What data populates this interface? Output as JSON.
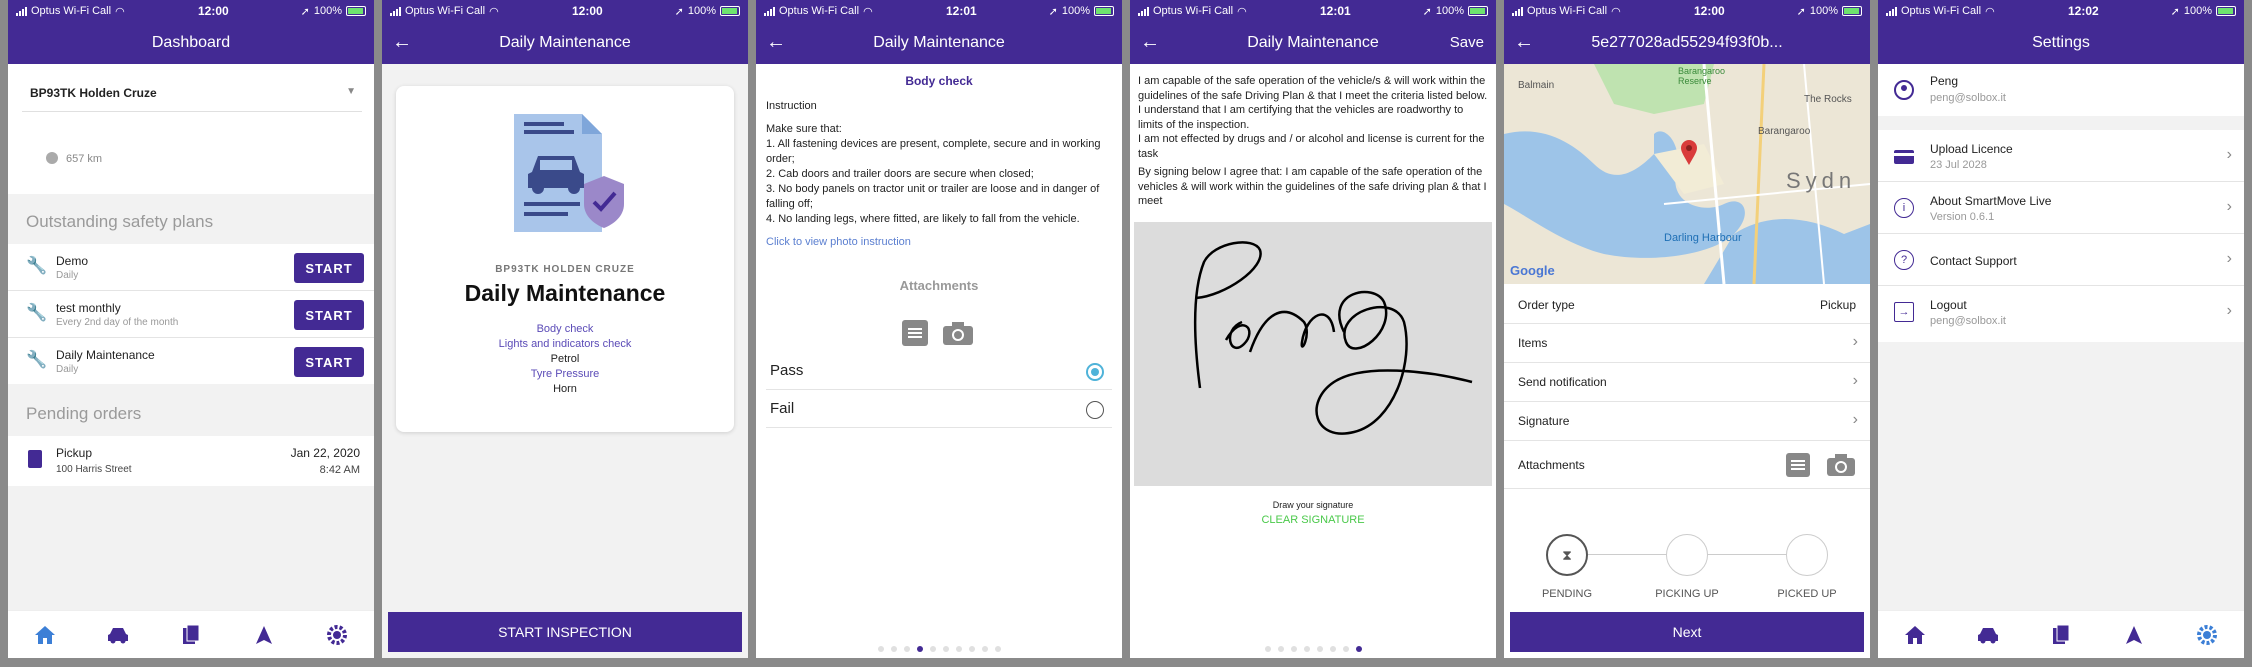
{
  "status": {
    "carrier": "Optus Wi-Fi Call",
    "battery": "100%",
    "times": [
      "12:00",
      "12:00",
      "12:01",
      "12:01",
      "12:00",
      "12:02"
    ]
  },
  "dashboard": {
    "title": "Dashboard",
    "vehicle": "BP93TK Holden Cruze",
    "odometer": "657 km",
    "safety_heading": "Outstanding safety plans",
    "plans": [
      {
        "name": "Demo",
        "freq": "Daily",
        "button": "START"
      },
      {
        "name": "test monthly",
        "freq": "Every 2nd day of the month",
        "button": "START"
      },
      {
        "name": "Daily Maintenance",
        "freq": "Daily",
        "button": "START"
      }
    ],
    "pending_heading": "Pending orders",
    "order": {
      "type": "Pickup",
      "address": "100 Harris Street",
      "date": "Jan 22, 2020",
      "time": "8:42 AM"
    }
  },
  "maintenance": {
    "title": "Daily Maintenance",
    "vehicle": "BP93TK HOLDEN CRUZE",
    "plan_name": "Daily Maintenance",
    "checks": [
      "Body check",
      "Lights and indicators check",
      "Petrol",
      "Tyre Pressure",
      "Horn"
    ],
    "start_button": "START INSPECTION"
  },
  "bodycheck": {
    "title": "Daily Maintenance",
    "heading": "Body check",
    "instruction_label": "Instruction",
    "instruction_lines": [
      "Make sure that:",
      "1. All fastening devices are present, complete, secure and in working order;",
      "2. Cab doors and trailer doors are secure when closed;",
      "3. No body panels on tractor unit or trailer are loose and in danger of falling off;",
      "4. No landing legs, where fitted, are likely to fall from the vehicle."
    ],
    "photo_link": "Click to view photo instruction",
    "attachments_label": "Attachments",
    "options": [
      "Pass",
      "Fail"
    ],
    "selected": "Pass"
  },
  "signature": {
    "title": "Daily Maintenance",
    "save": "Save",
    "para1": "I am capable of the safe operation of the vehicle/s & will work within the guidelines of the safe Driving Plan & that I meet the criteria listed below. I understand that I am certifying that the vehicles are roadworthy to limits of the inspection.",
    "para2": "I am not effected by drugs and / or alcohol and license is current for the task",
    "para3": "By signing below I agree that: I am capable of the safe operation of the vehicles & will work within the guidelines of the safe driving plan & that I meet",
    "draw_label": "Draw your signature",
    "clear_label": "CLEAR SIGNATURE"
  },
  "order": {
    "title": "5e277028ad55294f93f0b...",
    "map_labels": {
      "balmain": "Balmain",
      "reserve": "Barangaroo Reserve",
      "rocks": "The Rocks",
      "barangaroo": "Barangaroo",
      "sydney": "Sydn",
      "darling": "Darling Harbour",
      "google": "Google"
    },
    "order_type_label": "Order type",
    "order_type_value": "Pickup",
    "rows": [
      "Items",
      "Send notification",
      "Signature"
    ],
    "attachments_label": "Attachments",
    "steps": [
      "PENDING",
      "PICKING UP",
      "PICKED UP"
    ],
    "next_button": "Next"
  },
  "settings": {
    "title": "Settings",
    "user_name": "Peng",
    "user_email": "peng@solbox.it",
    "items": [
      {
        "label": "Upload Licence",
        "sub": "23 Jul 2028"
      },
      {
        "label": "About SmartMove Live",
        "sub": "Version 0.6.1"
      },
      {
        "label": "Contact Support",
        "sub": ""
      },
      {
        "label": "Logout",
        "sub": "peng@solbox.it"
      }
    ]
  },
  "colors": {
    "brand": "#432a94",
    "link": "#5b4bb7",
    "success": "#4ac94a",
    "radio": "#4fb3d9"
  }
}
